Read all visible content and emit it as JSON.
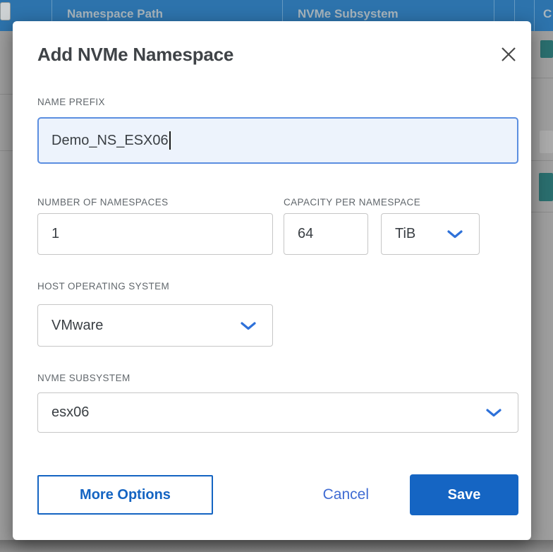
{
  "background_table": {
    "columns": [
      {
        "label": "Namespace Path"
      },
      {
        "label": "NVMe Subsystem"
      },
      {
        "label": "C"
      }
    ]
  },
  "dialog": {
    "title": "Add NVMe Namespace",
    "name_prefix": {
      "label": "NAME PREFIX",
      "value": "Demo_NS_ESX06"
    },
    "number_of_namespaces": {
      "label": "NUMBER OF NAMESPACES",
      "value": "1"
    },
    "capacity_per_namespace": {
      "label": "CAPACITY PER NAMESPACE",
      "value": "64",
      "unit": "TiB"
    },
    "host_operating_system": {
      "label": "HOST OPERATING SYSTEM",
      "value": "VMware"
    },
    "nvme_subsystem": {
      "label": "NVME SUBSYSTEM",
      "value": "esx06"
    },
    "buttons": {
      "more_options": "More Options",
      "cancel": "Cancel",
      "save": "Save"
    }
  },
  "colors": {
    "header_blue": "#2d73ac",
    "accent_blue": "#1565c3",
    "link_blue": "#3f6bd3",
    "focus_border": "#5b8ee0",
    "focus_background": "#edf3fc",
    "status_teal": "#2a6e6e"
  }
}
